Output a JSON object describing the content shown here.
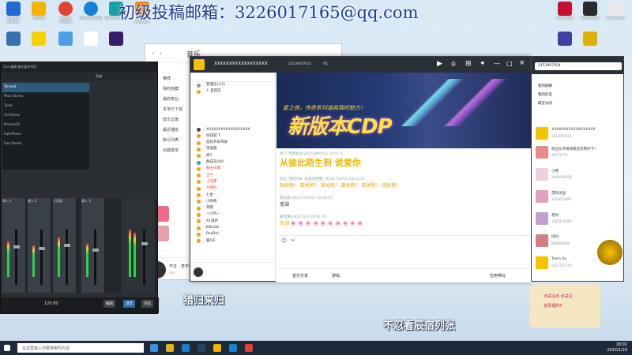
{
  "watermark": "初级投稿邮箱：3226017165@qq.com",
  "desktop_icons": [
    {
      "label": "Tencent Protect",
      "color": "#1e6bd6"
    },
    {
      "label": "腾讯QQ",
      "color": "#f5b400"
    },
    {
      "label": "Google Chrome",
      "color": "#e34133"
    },
    {
      "label": "Microsoft Edge",
      "color": "#1681d6"
    },
    {
      "label": "Microsoft Edge",
      "color": "#1aa0a0"
    },
    {
      "label": "Adobe Illustrator",
      "color": "#ff7c00"
    },
    {
      "label": "Among Us",
      "color": "#c8102e"
    },
    {
      "label": "Death Wish",
      "color": "#2a2a2a"
    },
    {
      "label": "Crab Game",
      "color": "#e8e8e8"
    }
  ],
  "mixer": {
    "title": "Cbx  编辑  格式要求代码",
    "transport": "开始",
    "tracks": [
      "Tencent",
      "Phon Stereo",
      "Tuner",
      "CH Stereo",
      "Phonon(S)",
      "Fwd Phone",
      "Fwd Stereo"
    ],
    "channel_labels": [
      "输入 1",
      "输入 2",
      "主通道",
      "输入 3"
    ],
    "time": "120.00",
    "buttons": [
      "编辑",
      "混音",
      "浏览"
    ]
  },
  "music": {
    "title": "音乐",
    "nav": [
      "推荐",
      "我的收藏",
      "我的电台",
      "本地与下载",
      "音乐云盘",
      "最近播放",
      "默认列表",
      "创建歌单"
    ],
    "playing_title": "不过 - 李宇春",
    "playing_sub": "不过"
  },
  "qq": {
    "group_name": "XXXXXXXXXXXXXXXXXX",
    "group_id": "1453907924",
    "online": "95",
    "members": [
      "管理员(1/2)",
      "↑ 是回开",
      "XXXXXXXXXXXXXXXXXX",
      "坑成就飞",
      "是妈开车驾驶",
      "李诚基",
      "周1",
      "群成员(94)",
      "群主凤情",
      "主气",
      "小天使",
      "大哥好",
      "七星",
      "小阳哥",
      "哥我",
      "~小鸡~",
      "A1骑驴",
      "BAIL0G",
      "RezDre",
      "最AIE"
    ],
    "banner_sub": "星之夜，传奇系列道具限时助力！",
    "banner_big": "新版本CDP",
    "messages": [
      {
        "who": "坑门-无聊紫龙(2025286052)  18:02:3",
        "text": "从彼此陌生到  说爱你",
        "big": true
      },
      {
        "who": "花化 (我是FW, 会自动回哦) (414175972)  18:02:25",
        "text": "现抢购！  现抢购！  现抢购！  现抢购！  现抢购！  现抢购！",
        "hint": true
      },
      {
        "who": "紫仙君(3431774792)  18:02:05",
        "text": "宽湖",
        "big": false
      },
      {
        "who": "最优惠(1931513)  18:02:29",
        "text": "宽湖 🌸 🌸 🌸 🌸 🌸 🌸 🌸 🌸 🌸 🌸",
        "big": false
      }
    ],
    "input_placeholder": "",
    "send_label": "应用神马",
    "tools": [
      "音乐分享",
      "游戏"
    ]
  },
  "contacts": {
    "search": "1453907924",
    "tabs": [
      "我的群聊",
      "我的好友",
      "最近访问"
    ],
    "items": [
      {
        "name": "XXXXXXXXXXXXXXXXXX",
        "sub": "1453907924",
        "color": "#f5c400"
      },
      {
        "name": "初信伙伴爽快稳定的熊仔卡！",
        "sub": "40771773",
        "color": "#e88a8a"
      },
      {
        "name": "小熊",
        "sub": "1460040439",
        "color": "#f0d0e0"
      },
      {
        "name": "漂亮乐园",
        "sub": "1422622669",
        "color": "#e0a0c0"
      },
      {
        "name": "老妈",
        "sub": "1485471464",
        "color": "#c0a0d0"
      },
      {
        "name": "BBQ",
        "sub": "894890888",
        "color": "#d08080"
      },
      {
        "name": "Team Xy",
        "sub": "1463751170",
        "color": "#f5c400"
      }
    ]
  },
  "overlay": {
    "lyric1": "猎归来归",
    "lyric2": "不忍看辰宿列张",
    "promo": "点关注点 点关注",
    "promo2": "会员福利4"
  },
  "taskbar": {
    "search_placeholder": "在这里输入你要搜索的内容",
    "time": "18:02",
    "date": "2022/1/20"
  }
}
